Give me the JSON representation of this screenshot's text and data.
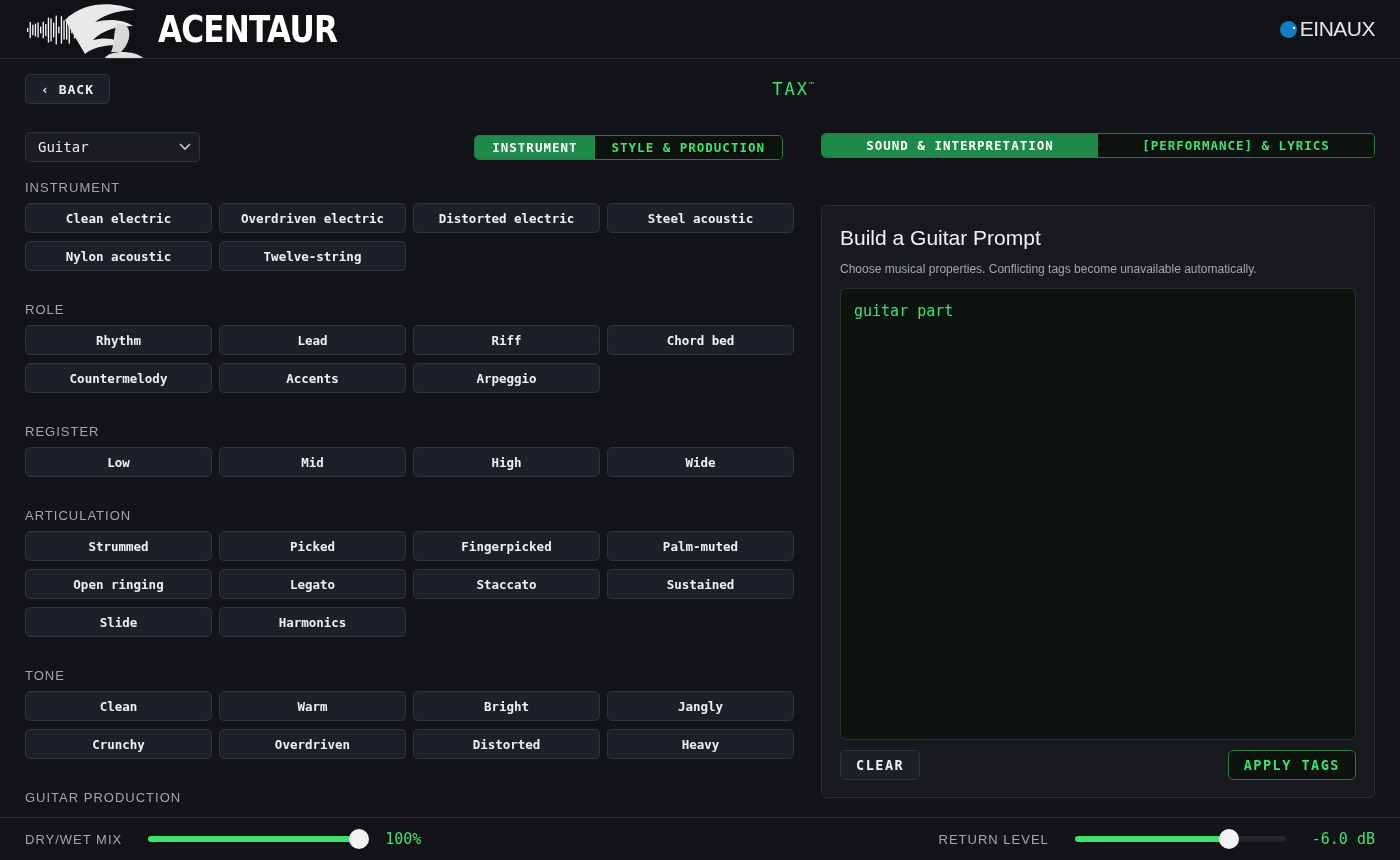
{
  "brand": {
    "name": "ACENTAUR",
    "partner": "EINAUX"
  },
  "back": "‹ BACK",
  "title": "TAX$^{™}$",
  "instrument_select": {
    "value": "Guitar"
  },
  "left_tabs": [
    {
      "label": "INSTRUMENT",
      "selected": true
    },
    {
      "label": "STYLE & PRODUCTION",
      "selected": false
    }
  ],
  "right_tabs": [
    {
      "label": "SOUND & INTERPRETATION",
      "selected": true
    },
    {
      "label": "[PERFORMANCE] & LYRICS",
      "selected": false
    }
  ],
  "sections": [
    {
      "title": "INSTRUMENT",
      "tags": [
        "Clean electric",
        "Overdriven electric",
        "Distorted electric",
        "Steel acoustic",
        "Nylon acoustic",
        "Twelve-string"
      ]
    },
    {
      "title": "ROLE",
      "tags": [
        "Rhythm",
        "Lead",
        "Riff",
        "Chord bed",
        "Countermelody",
        "Accents",
        "Arpeggio"
      ]
    },
    {
      "title": "REGISTER",
      "tags": [
        "Low",
        "Mid",
        "High",
        "Wide"
      ]
    },
    {
      "title": "ARTICULATION",
      "tags": [
        "Strummed",
        "Picked",
        "Fingerpicked",
        "Palm-muted",
        "Open ringing",
        "Legato",
        "Staccato",
        "Sustained",
        "Slide",
        "Harmonics"
      ]
    },
    {
      "title": "TONE",
      "tags": [
        "Clean",
        "Warm",
        "Bright",
        "Jangly",
        "Crunchy",
        "Overdriven",
        "Distorted",
        "Heavy"
      ]
    },
    {
      "title": "GUITAR PRODUCTION"
    }
  ],
  "prompt": {
    "title": "Build a Guitar Prompt",
    "hint": "Choose musical properties. Conflicting tags become unavailable automatically.",
    "text": "guitar part",
    "buttons": [
      {
        "label": "CLEAR",
        "kind": "plain"
      },
      {
        "label": "APPLY TAGS",
        "kind": "accent"
      }
    ]
  },
  "footer": [
    {
      "label": "DRY/WET MIX",
      "level": 1.0,
      "reading": "100%"
    },
    {
      "label": "RETURN LEVEL",
      "level": 0.73,
      "reading": "-6.0 dB"
    }
  ]
}
